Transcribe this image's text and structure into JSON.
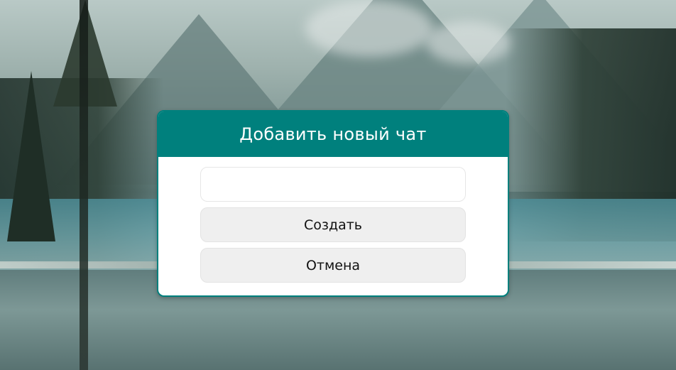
{
  "dialog": {
    "title": "Добавить новый чат",
    "chat_name_input": {
      "value": "",
      "placeholder": ""
    },
    "create_label": "Создать",
    "cancel_label": "Отмена"
  },
  "colors": {
    "accent": "#00807d",
    "button_bg": "#efefef",
    "dialog_bg": "#ffffff"
  }
}
